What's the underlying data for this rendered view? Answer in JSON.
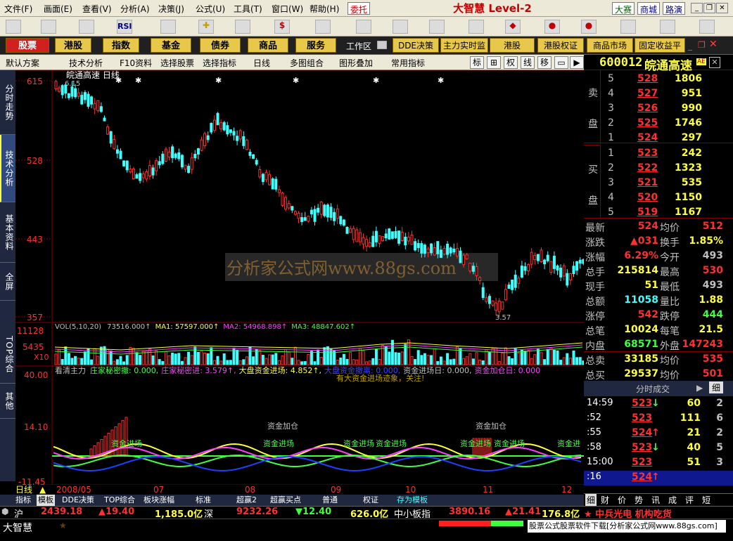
{
  "menu": {
    "items": [
      "文件(F)",
      "画面(E)",
      "查看(V)",
      "分析(A)",
      "决策(J)",
      "公式(U)",
      "工具(T)",
      "窗口(W)",
      "帮助(H)"
    ],
    "entrust": "委托",
    "brand": "大智慧 Level-2",
    "right_tags": [
      "大赛",
      "商城",
      "路演"
    ]
  },
  "mainbar": {
    "items": [
      "股票",
      "港股",
      "指数",
      "基金",
      "债券",
      "商品",
      "服务"
    ],
    "workarea": "工作区",
    "extras": [
      "DDE决策",
      "主力实时监控",
      "港股",
      "港股权证",
      "商品市场",
      "固定收益平台"
    ]
  },
  "subbar": {
    "items": [
      "默认方案",
      "技术分析",
      "F10资料",
      "选择股票",
      "选择指标",
      "日线",
      "多图组合",
      "图形叠加",
      "常用指标"
    ],
    "right": [
      "标",
      "权",
      "线",
      "移"
    ]
  },
  "left_tabs": [
    "分时走势",
    "技术分析",
    "基本资料",
    "全屏",
    "TOP综合",
    "其他"
  ],
  "stock": {
    "code": "600012",
    "name": "皖通高速",
    "tag": "AE"
  },
  "chart_title": "皖通高速 日线",
  "watermark": "分析家公式网www.88gs.com",
  "price_axis": [
    "615",
    "528",
    "443",
    "357"
  ],
  "hi_label": "6.15",
  "lo_label": "3.57",
  "vol_line": {
    "label": "VOL(5,10,20)",
    "value": "73516.000↑",
    "ma1": "MA1: 57597.000↑",
    "ma2": "MA2: 54968.898↑",
    "ma3": "MA3: 48847.602↑"
  },
  "vol_axis": [
    "11128",
    "5435",
    "X10"
  ],
  "ind_line": {
    "label": "看清主力",
    "t1": "庄家秘密撤: 0.000,",
    "t2": "庄家秘密进: 3.579↑,",
    "t3": "大盘资金进场: 4.852↑,",
    "t4": "大盘资金撤离: 0.000,",
    "t5": "资金进场日: 0.000,",
    "t6": "资金加仓日: 0.000"
  },
  "ind_note": "有大资金进场迹象，关注!",
  "ind_axis": [
    "40.00",
    "14.10",
    "-11.45"
  ],
  "ind_text": [
    "资金进场",
    "资金加仓",
    "资金进场",
    "资金进场",
    "资金进场",
    "资金进场",
    "资金加仓",
    "资金进场",
    "资金进"
  ],
  "xaxis": [
    "2008/05",
    "07",
    "08",
    "09",
    "10",
    "11",
    "12"
  ],
  "period": "日线",
  "bottom_tabs": [
    "指标",
    "模板",
    "DDE决策",
    "TOP综合",
    "板块涨幅",
    "标准",
    "超赢2",
    "超赢买点",
    "普通",
    "权证",
    "存为模板"
  ],
  "orderbook": {
    "sell_label": [
      "卖",
      "盘"
    ],
    "buy_label": [
      "买",
      "盘"
    ],
    "sell": [
      {
        "n": "5",
        "p": "528",
        "v": "1806"
      },
      {
        "n": "4",
        "p": "527",
        "v": "951"
      },
      {
        "n": "3",
        "p": "526",
        "v": "990"
      },
      {
        "n": "2",
        "p": "525",
        "v": "1746"
      },
      {
        "n": "1",
        "p": "524",
        "v": "297"
      }
    ],
    "buy": [
      {
        "n": "1",
        "p": "523",
        "v": "242"
      },
      {
        "n": "2",
        "p": "522",
        "v": "1323"
      },
      {
        "n": "3",
        "p": "521",
        "v": "535"
      },
      {
        "n": "4",
        "p": "520",
        "v": "1150"
      },
      {
        "n": "5",
        "p": "519",
        "v": "1167"
      }
    ]
  },
  "quote": [
    {
      "l1": "最新",
      "v1": "524",
      "c1": "#ff3030",
      "l2": "均价",
      "v2": "512",
      "c2": "#ff3030"
    },
    {
      "l1": "涨跌",
      "v1": "▲031",
      "c1": "#ff3030",
      "l2": "换手",
      "v2": "1.85%",
      "c2": "#ffff40"
    },
    {
      "l1": "涨幅",
      "v1": "6.29%",
      "c1": "#ff3030",
      "l2": "今开",
      "v2": "493",
      "c2": "#c0c0c0"
    },
    {
      "l1": "总手",
      "v1": "215814",
      "c1": "#ffff40",
      "l2": "最高",
      "v2": "530",
      "c2": "#ff3030"
    },
    {
      "l1": "现手",
      "v1": "51",
      "c1": "#ffff40",
      "l2": "最低",
      "v2": "493",
      "c2": "#c0c0c0"
    },
    {
      "l1": "总额",
      "v1": "11058",
      "c1": "#40ffff",
      "l2": "量比",
      "v2": "1.88",
      "c2": "#ffff40"
    },
    {
      "l1": "涨停",
      "v1": "542",
      "c1": "#ff3030",
      "l2": "跌停",
      "v2": "444",
      "c2": "#40ff40"
    },
    {
      "l1": "总笔",
      "v1": "10024",
      "c1": "#ffff40",
      "l2": "每笔",
      "v2": "21.5",
      "c2": "#ffff40"
    },
    {
      "l1": "内盘",
      "v1": "68571",
      "c1": "#40ff40",
      "l2": "外盘",
      "v2": "147243",
      "c2": "#ff3030"
    },
    {
      "l1": "总卖",
      "v1": "33185",
      "c1": "#ffff40",
      "l2": "均价",
      "v2": "535",
      "c2": "#ff3030"
    },
    {
      "l1": "总买",
      "v1": "29537",
      "c1": "#ffff40",
      "l2": "均价",
      "v2": "501",
      "c2": "#ff3030"
    }
  ],
  "ticks_header": "分时成交",
  "ticks_header_btn": "细",
  "ticks": [
    {
      "t": "14:59",
      "p": "523",
      "a": "↓",
      "ac": "#40ff40",
      "v": "60",
      "n": "2"
    },
    {
      "t": ":52",
      "p": "523",
      "a": "",
      "ac": "",
      "v": "111",
      "n": "6"
    },
    {
      "t": ":55",
      "p": "524",
      "a": "↑",
      "ac": "#ff3030",
      "v": "21",
      "n": "2"
    },
    {
      "t": ":58",
      "p": "523",
      "a": "↓",
      "ac": "#40ff40",
      "v": "40",
      "n": "5"
    },
    {
      "t": "15:00",
      "p": "523",
      "a": "",
      "ac": "",
      "v": "51",
      "n": "3"
    },
    {
      "t": ":16",
      "p": "524",
      "a": "↑",
      "ac": "#ff3030",
      "v": "",
      "n": ""
    }
  ],
  "right_tabs": [
    "细",
    "财",
    "价",
    "势",
    "讯",
    "成",
    "评",
    "短"
  ],
  "index": {
    "sh": "沪",
    "sh_v": "2439.18",
    "sh_c": "▲19.40",
    "sh_a": "1,185.0亿",
    "sz": "深",
    "sz_v": "9232.26",
    "sz_c": "▼12.40",
    "sz_a": "626.0亿",
    "sm": "中小板指",
    "sm_v": "3890.16",
    "sm_c": "▲21.41",
    "sm_a": "176.8亿",
    "news": "★ 中兵光电 机构吃货"
  },
  "status": {
    "logo": "大智慧",
    "ad": "股票公式股票软件下载[分析家公式网www.88gs.com]"
  }
}
